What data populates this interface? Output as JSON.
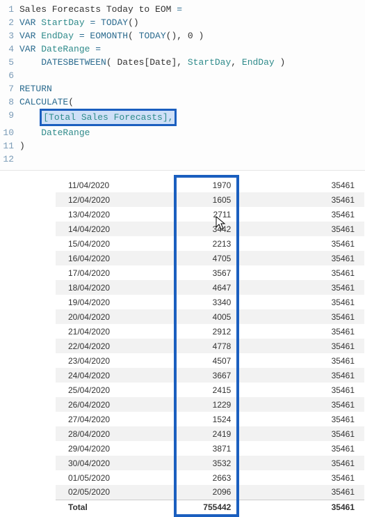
{
  "code": {
    "lines": [
      {
        "n": "1",
        "t": [
          {
            "c": "txt",
            "s": "Sales Forecasts Today to EOM "
          },
          {
            "c": "kw",
            "s": "="
          }
        ]
      },
      {
        "n": "2",
        "t": [
          {
            "c": "kw",
            "s": "VAR "
          },
          {
            "c": "var",
            "s": "StartDay"
          },
          {
            "c": "kw",
            "s": " = TODAY"
          },
          {
            "c": "txt",
            "s": "()"
          }
        ]
      },
      {
        "n": "3",
        "t": [
          {
            "c": "kw",
            "s": "VAR "
          },
          {
            "c": "var",
            "s": "EndDay"
          },
          {
            "c": "kw",
            "s": " = EOMONTH"
          },
          {
            "c": "txt",
            "s": "( "
          },
          {
            "c": "kw",
            "s": "TODAY"
          },
          {
            "c": "txt",
            "s": "(), "
          },
          {
            "c": "num",
            "s": "0"
          },
          {
            "c": "txt",
            "s": " )"
          }
        ]
      },
      {
        "n": "4",
        "t": [
          {
            "c": "kw",
            "s": "VAR "
          },
          {
            "c": "var",
            "s": "DateRange"
          },
          {
            "c": "kw",
            "s": " ="
          }
        ]
      },
      {
        "n": "5",
        "t": [
          {
            "c": "txt",
            "s": "    "
          },
          {
            "c": "kw",
            "s": "DATESBETWEEN"
          },
          {
            "c": "txt",
            "s": "( Dates[Date], "
          },
          {
            "c": "var",
            "s": "StartDay"
          },
          {
            "c": "txt",
            "s": ", "
          },
          {
            "c": "var",
            "s": "EndDay"
          },
          {
            "c": "txt",
            "s": " )"
          }
        ]
      },
      {
        "n": "6",
        "t": []
      },
      {
        "n": "7",
        "t": [
          {
            "c": "kw",
            "s": "RETURN"
          }
        ]
      },
      {
        "n": "8",
        "t": [
          {
            "c": "kw",
            "s": "CALCULATE"
          },
          {
            "c": "txt",
            "s": "("
          }
        ]
      },
      {
        "n": "9",
        "t": [
          {
            "c": "txt",
            "s": "    "
          },
          {
            "c": "hl",
            "s": "[Total Sales Forecasts],"
          }
        ]
      },
      {
        "n": "10",
        "t": [
          {
            "c": "txt",
            "s": "    "
          },
          {
            "c": "var",
            "s": "DateRange"
          }
        ]
      },
      {
        "n": "11",
        "t": [
          {
            "c": "txt",
            "s": ")"
          }
        ]
      },
      {
        "n": "12",
        "t": []
      }
    ]
  },
  "table": {
    "rows": [
      {
        "date": "11/04/2020",
        "a": "1970",
        "b": "35461"
      },
      {
        "date": "12/04/2020",
        "a": "1605",
        "b": "35461"
      },
      {
        "date": "13/04/2020",
        "a": "2711",
        "b": "35461"
      },
      {
        "date": "14/04/2020",
        "a": "3442",
        "b": "35461"
      },
      {
        "date": "15/04/2020",
        "a": "2213",
        "b": "35461"
      },
      {
        "date": "16/04/2020",
        "a": "4705",
        "b": "35461"
      },
      {
        "date": "17/04/2020",
        "a": "3567",
        "b": "35461"
      },
      {
        "date": "18/04/2020",
        "a": "4647",
        "b": "35461"
      },
      {
        "date": "19/04/2020",
        "a": "3340",
        "b": "35461"
      },
      {
        "date": "20/04/2020",
        "a": "4005",
        "b": "35461"
      },
      {
        "date": "21/04/2020",
        "a": "2912",
        "b": "35461"
      },
      {
        "date": "22/04/2020",
        "a": "4778",
        "b": "35461"
      },
      {
        "date": "23/04/2020",
        "a": "4507",
        "b": "35461"
      },
      {
        "date": "24/04/2020",
        "a": "3667",
        "b": "35461"
      },
      {
        "date": "25/04/2020",
        "a": "2415",
        "b": "35461"
      },
      {
        "date": "26/04/2020",
        "a": "1229",
        "b": "35461"
      },
      {
        "date": "27/04/2020",
        "a": "1524",
        "b": "35461"
      },
      {
        "date": "28/04/2020",
        "a": "2419",
        "b": "35461"
      },
      {
        "date": "29/04/2020",
        "a": "3871",
        "b": "35461"
      },
      {
        "date": "30/04/2020",
        "a": "3532",
        "b": "35461"
      },
      {
        "date": "01/05/2020",
        "a": "2663",
        "b": "35461"
      },
      {
        "date": "02/05/2020",
        "a": "2096",
        "b": "35461"
      }
    ],
    "total_label": "Total",
    "total_a": "755442",
    "total_b": "35461"
  }
}
